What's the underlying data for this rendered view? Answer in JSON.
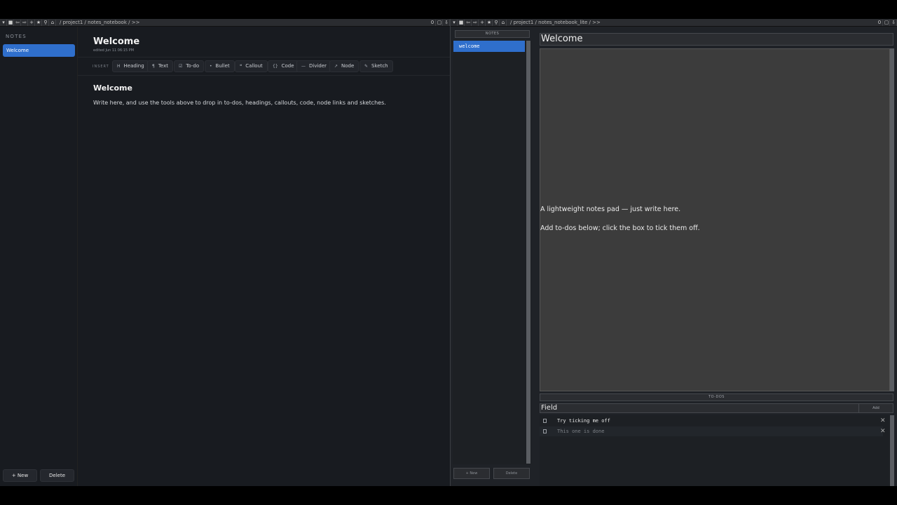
{
  "left_window": {
    "toolbar": {
      "path": "/ project1 / notes_notebook / >>",
      "counter": "0"
    },
    "sidebar": {
      "heading": "NOTES",
      "notes": [
        {
          "label": "Welcome"
        }
      ],
      "new_label": "+ New",
      "delete_label": "Delete"
    },
    "main": {
      "title": "Welcome",
      "edited": "edited Jun 11 06:15 PM",
      "insert_label": "INSERT",
      "insert_buttons": [
        {
          "icon": "H",
          "label": "Heading"
        },
        {
          "icon": "¶",
          "label": "Text"
        },
        {
          "icon": "☑",
          "label": "To-do"
        },
        {
          "icon": "•",
          "label": "Bullet"
        },
        {
          "icon": "❝",
          "label": "Callout"
        },
        {
          "icon": "{}",
          "label": "Code"
        },
        {
          "icon": "—",
          "label": "Divider"
        },
        {
          "icon": "↗",
          "label": "Node"
        },
        {
          "icon": "✎",
          "label": "Sketch"
        }
      ],
      "doc_heading": "Welcome",
      "doc_paragraph": "Write here, and use the tools above to drop in to-dos, headings, callouts, code, node links and sketches."
    }
  },
  "right_window": {
    "toolbar": {
      "path": "/ project1 / notes_notebook_lite / >>",
      "counter": "0"
    },
    "list": {
      "header": "NOTES",
      "items": [
        {
          "label": "welcome"
        }
      ],
      "new_label": "+ New",
      "delete_label": "Delete"
    },
    "main": {
      "title": "Welcome",
      "body_lines": [
        "A lightweight notes pad — just write here.",
        "Add to-dos below; click the box to tick them off."
      ],
      "todos_header": "TO-DOS",
      "field_placeholder": "Field",
      "add_label": "Add",
      "todos": [
        {
          "text": "Try ticking me off",
          "done": false
        },
        {
          "text": "This one is done",
          "done": true
        }
      ]
    }
  }
}
